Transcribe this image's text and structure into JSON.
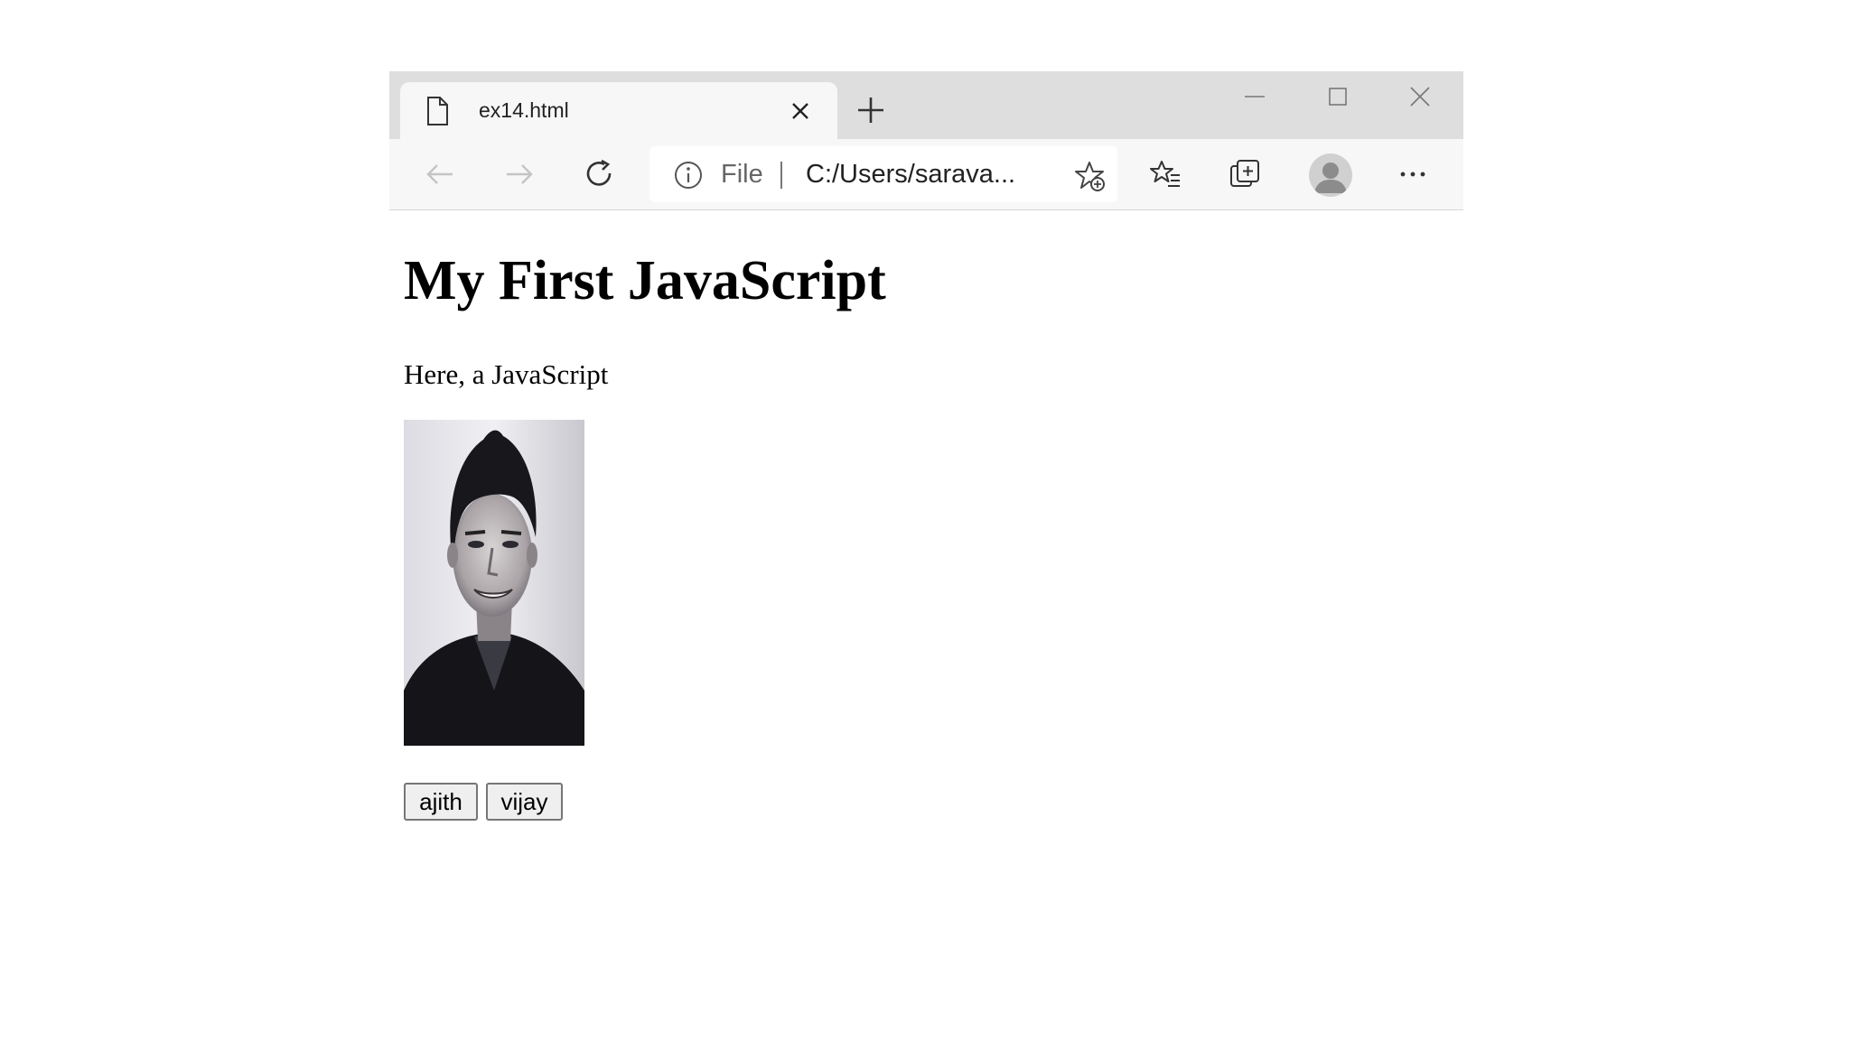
{
  "browser": {
    "tab": {
      "title": "ex14.html"
    },
    "address_bar": {
      "scheme_label": "File",
      "url": "C:/Users/sarava..."
    }
  },
  "page": {
    "heading": "My First JavaScript",
    "paragraph": "Here, a JavaScript",
    "image_alt": "portrait photo",
    "buttons": [
      {
        "label": "ajith"
      },
      {
        "label": "vijay"
      }
    ]
  }
}
